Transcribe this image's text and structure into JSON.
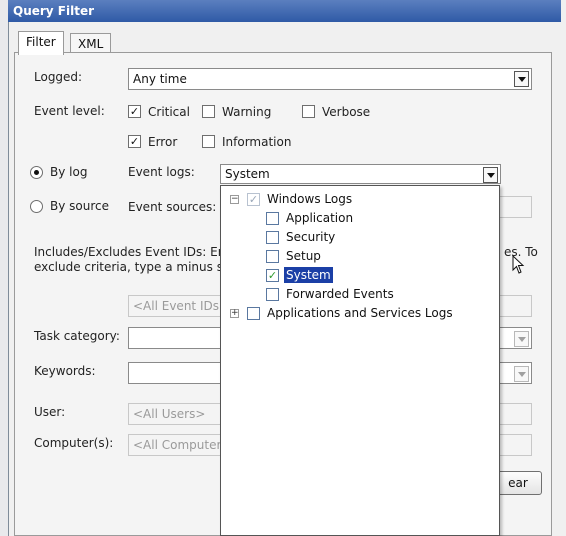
{
  "window": {
    "title": "Query Filter"
  },
  "tabs": [
    {
      "label": "Filter"
    },
    {
      "label": "XML"
    }
  ],
  "form": {
    "logged": {
      "label": "Logged:",
      "value": "Any time"
    },
    "event_level": {
      "label": "Event level:",
      "options": [
        {
          "label": "Critical",
          "checked": true
        },
        {
          "label": "Warning",
          "checked": false
        },
        {
          "label": "Verbose",
          "checked": false
        },
        {
          "label": "Error",
          "checked": true
        },
        {
          "label": "Information",
          "checked": false
        }
      ]
    },
    "by_log": {
      "label": "By log",
      "selected": true
    },
    "by_source": {
      "label": "By source",
      "selected": false
    },
    "event_logs": {
      "label": "Event logs:",
      "value": "System"
    },
    "event_sources": {
      "label": "Event sources:"
    },
    "event_ids": {
      "description_line1": "Includes/Excludes Event IDs: Enter",
      "description_line1_tail": "es. To",
      "description_line2": "exclude criteria, type a minus sign",
      "placeholder": "<All Event IDs>"
    },
    "task_category": {
      "label": "Task category:"
    },
    "keywords": {
      "label": "Keywords:"
    },
    "user": {
      "label": "User:",
      "placeholder": "<All Users>"
    },
    "computer": {
      "label": "Computer(s):",
      "placeholder": "<All Computers"
    },
    "clear_button": {
      "label": "ear"
    }
  },
  "tree": {
    "root": {
      "label": "Windows Logs",
      "expander": "−",
      "state": "partial"
    },
    "children": [
      {
        "label": "Application",
        "checked": false,
        "selected": false
      },
      {
        "label": "Security",
        "checked": false,
        "selected": false
      },
      {
        "label": "Setup",
        "checked": false,
        "selected": false
      },
      {
        "label": "System",
        "checked": true,
        "selected": true
      },
      {
        "label": "Forwarded Events",
        "checked": false,
        "selected": false
      }
    ],
    "second_root": {
      "label": "Applications and Services Logs",
      "expander": "+"
    }
  },
  "glyphs": {
    "check": "✓",
    "partial": "✓"
  },
  "colors": {
    "selection": "#1b3fa6",
    "title_bar": "#2f5aa6",
    "tree_check": "#2e9a2e"
  }
}
